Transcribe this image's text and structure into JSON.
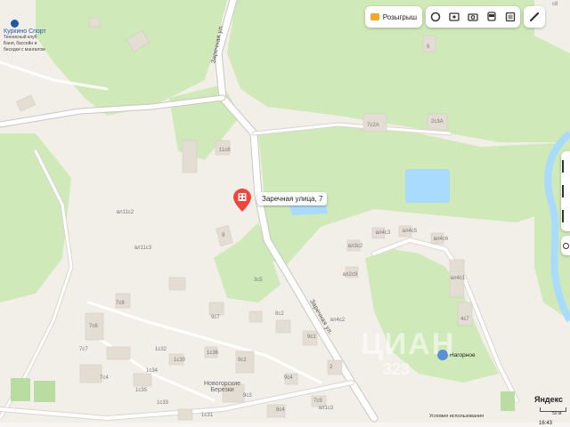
{
  "map": {
    "colors": {
      "land": "#f2efe9",
      "forest": "#cfe9b8",
      "water": "#a9dbff",
      "building": "#e3ddd3",
      "road": "#ffffff",
      "road_edge": "#c9c7c2",
      "marker": "#f1453d"
    }
  },
  "toolbar": {
    "promo_label": "Розыгрыш",
    "promo_icon": "gift-icon",
    "icons": [
      "layers-icon",
      "panorama-icon",
      "camera-icon",
      "bus-icon",
      "more-layers-icon"
    ],
    "ruler_icon": "ruler-icon"
  },
  "marker": {
    "label": "Заречная улица, 7",
    "icon": "building-marker-icon"
  },
  "poi": {
    "kurkino": {
      "name": "Куркино Спорт",
      "sub1": "Теннисный клуб",
      "sub2": "Баня, бассейн и",
      "sub3": "беседки с мангалом"
    },
    "nagornoe": {
      "name": "Нагорное"
    },
    "berezki": {
      "line1": "Новогорские",
      "line2": "Березки"
    }
  },
  "streets": {
    "zarechnaya": "Заречная ул.",
    "zarechnaya2": "Заречная ул."
  },
  "house_numbers": {
    "h11c8": "11с8",
    "h7c2A": "7с2А",
    "h2c3A": "2с3А",
    "h9": "9",
    "h11c2": "вл11с2",
    "h11c3": "вл11с3",
    "h3c5": "3с5",
    "h9b": "9",
    "h7c8": "7с8",
    "h7c4": "7с4",
    "h7c6": "7с6",
    "h7c7": "7с7",
    "h7c3": "7с3",
    "h9c7": "9с7",
    "h9c1": "9с1",
    "h7c5": "7с5",
    "h7c1": "7с1",
    "h8c2": "8с2",
    "h1c32": "1с32",
    "h1c30": "1с30",
    "h1c34": "1с34",
    "h1c35": "1с35",
    "h1c33": "1с33",
    "h1c36": "1с36",
    "h1c31": "1с31",
    "h9c2": "9с2",
    "h9c3": "9с3",
    "h8c4": "8с4",
    "h9c4": "9с4",
    "h8c6": "вл4с3",
    "h8c5": "вл4с5",
    "h4c6": "вл4с6",
    "h4c7": "4с7",
    "h4c2": "вл4с2",
    "h3c2": "вл3с2",
    "h2c9": "вл2с9",
    "h4c1": "вл4с1",
    "h2": "2",
    "h7c9": "7с9",
    "h1c3": "вл1с3",
    "h2c8": "2с8",
    "h8c8": "с8"
  },
  "attribution": {
    "links": "Условия использования",
    "brand": "Яндекс",
    "scale": "50 м",
    "time": "16:43"
  },
  "watermark": {
    "line1": "ЦИАН",
    "line2": "323"
  }
}
